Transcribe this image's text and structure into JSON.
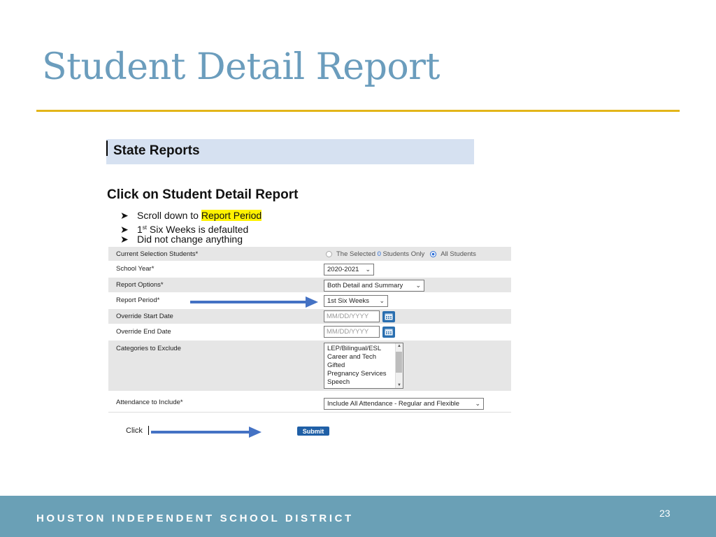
{
  "slide": {
    "title": "Student Detail Report",
    "page_number": "23",
    "footer": "HOUSTON INDEPENDENT SCHOOL DISTRICT"
  },
  "colors": {
    "title": "#6b9dbd",
    "rule": "#e3b51a",
    "footer_bg": "#6aa0b6",
    "header_bar": "#d6e1f1",
    "arrow": "#4472c4",
    "highlight": "#fff200"
  },
  "screenshot": {
    "header": "State Reports",
    "instruction_heading": "Click on Student Detail Report",
    "bullets": [
      {
        "prefix": "Scroll down to ",
        "highlight": "Report Period"
      },
      {
        "prefix": "1",
        "sup": "st",
        "suffix": " Six Weeks is defaulted"
      },
      {
        "prefix": "Did not change anything"
      }
    ],
    "form": {
      "current_selection": {
        "label": "Current Selection Students*",
        "option_selected_pre": "The Selected ",
        "option_selected_count": "0",
        "option_selected_post": " Students Only",
        "option_all": "All Students",
        "selected": "All Students"
      },
      "school_year": {
        "label": "School Year*",
        "value": "2020-2021"
      },
      "report_options": {
        "label": "Report Options*",
        "value": "Both Detail and Summary"
      },
      "report_period": {
        "label": "Report Period*",
        "value": "1st Six Weeks"
      },
      "override_start": {
        "label": "Override Start Date",
        "placeholder": "MM/DD/YYYY"
      },
      "override_end": {
        "label": "Override End Date",
        "placeholder": "MM/DD/YYYY"
      },
      "categories": {
        "label": "Categories to Exclude",
        "options": [
          "LEP/Bilingual/ESL",
          "Career and Tech",
          "Gifted",
          "Pregnancy Services",
          "Speech"
        ]
      },
      "attendance": {
        "label": "Attendance to Include*",
        "value": "Include All Attendance - Regular and Flexible"
      }
    },
    "click_label": "Click",
    "submit_label": "Submit"
  }
}
